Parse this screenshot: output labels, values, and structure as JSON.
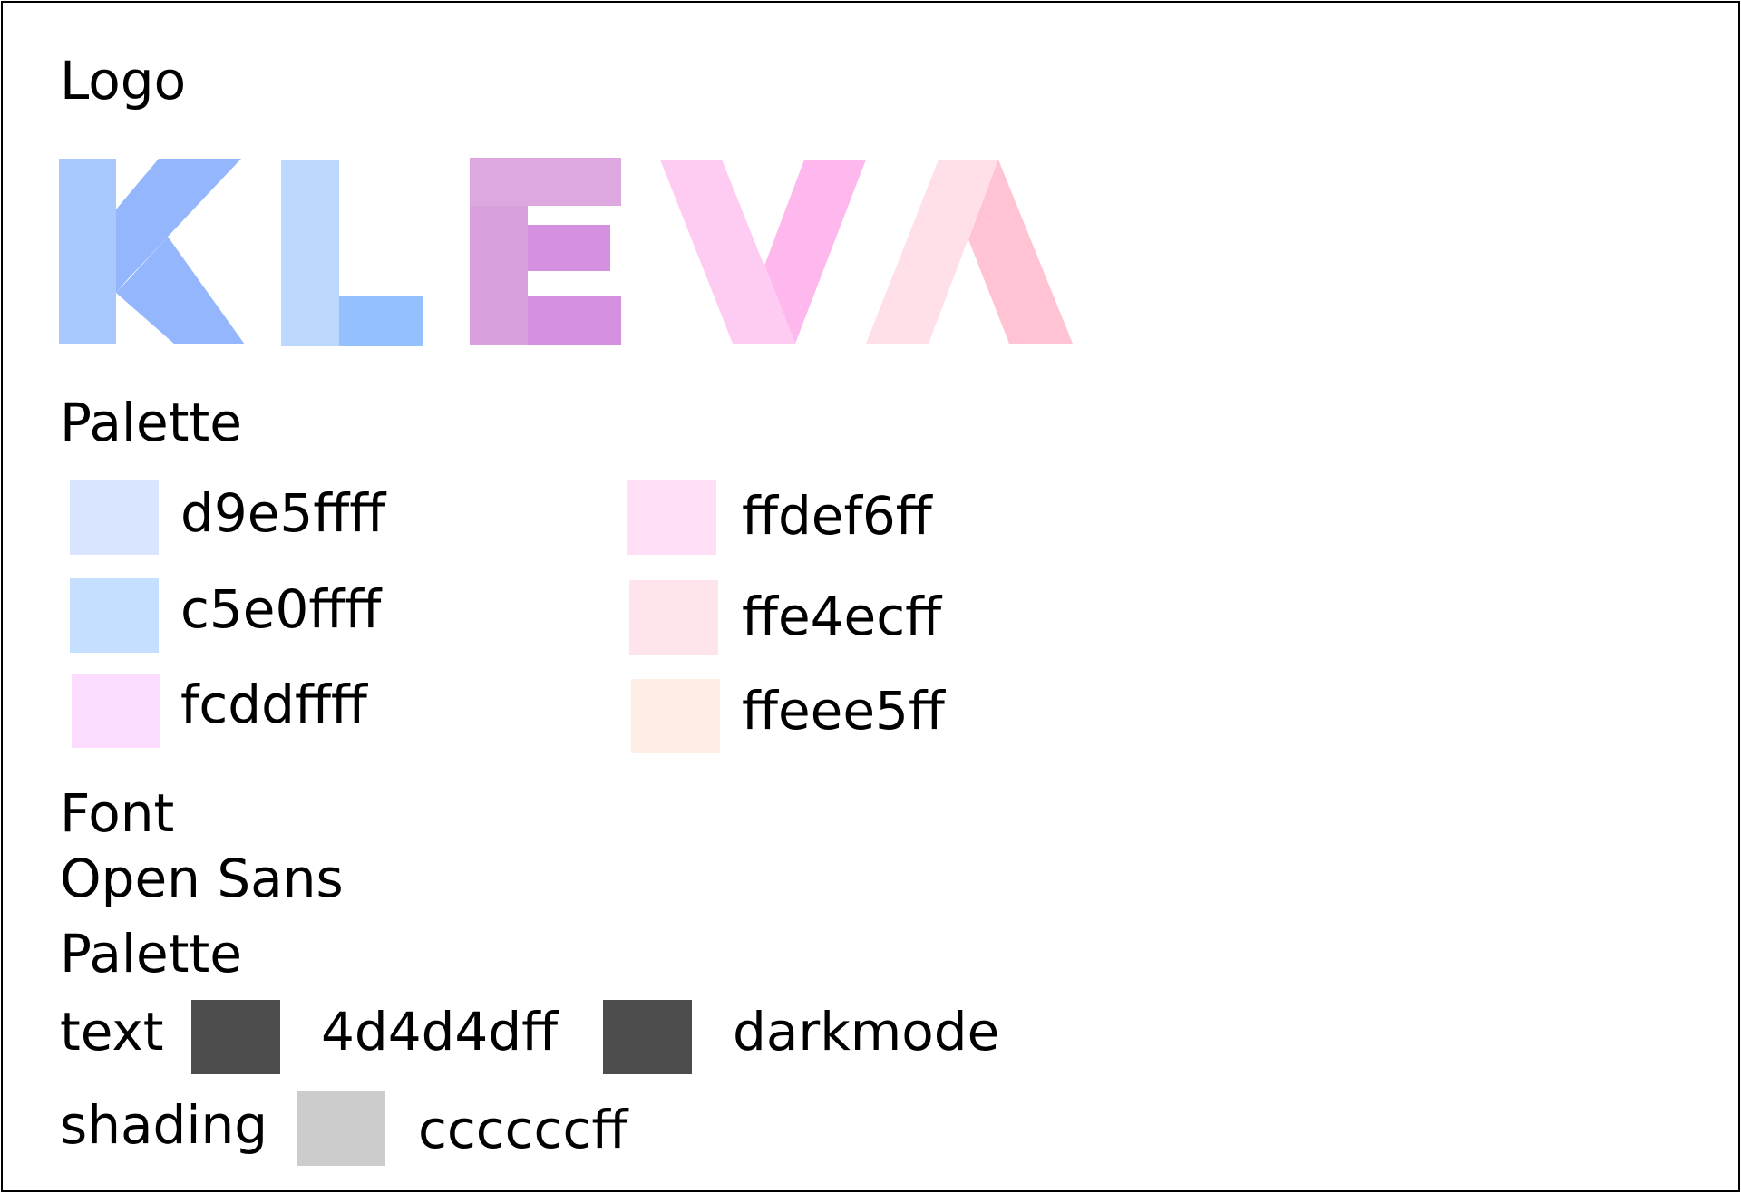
{
  "sections": {
    "logo_heading": "Logo",
    "palette_heading": "Palette",
    "font_heading": "Font",
    "font_name": "Open Sans",
    "palette2_heading": "Palette"
  },
  "logo": {
    "text": "KLEVA",
    "colors": {
      "k_left": "#a9c8fc",
      "k_arms": "#94b6fc",
      "l_stem": "#bdd8ff",
      "l_foot": "#93c1fe",
      "e_top": "#dda8e0",
      "e_stem": "#d9a0dd",
      "e_bars": "#d690e2",
      "v_left": "#fecbf2",
      "v_right": "#feb8ee",
      "a_left": "#ffe0e8",
      "a_right": "#ffc3d3"
    }
  },
  "palette": [
    {
      "label": "d9e5ffff",
      "color": "#d9e5ff"
    },
    {
      "label": "c5e0ffff",
      "color": "#c5e0ff"
    },
    {
      "label": "fcddffff",
      "color": "#fcddff"
    },
    {
      "label": "ffdef6ff",
      "color": "#ffdef6"
    },
    {
      "label": "ffe4ecff",
      "color": "#ffe4ec"
    },
    {
      "label": "ffeee5ff",
      "color": "#ffeee5"
    }
  ],
  "palette2": {
    "text_label": "text",
    "text_color": "#4d4d4d",
    "text_value": "4d4d4dff",
    "darkmode_color": "#4d4d4d",
    "darkmode_label": "darkmode",
    "shading_label": "shading",
    "shading_color": "#cccccc",
    "shading_value": "ccccccff"
  }
}
